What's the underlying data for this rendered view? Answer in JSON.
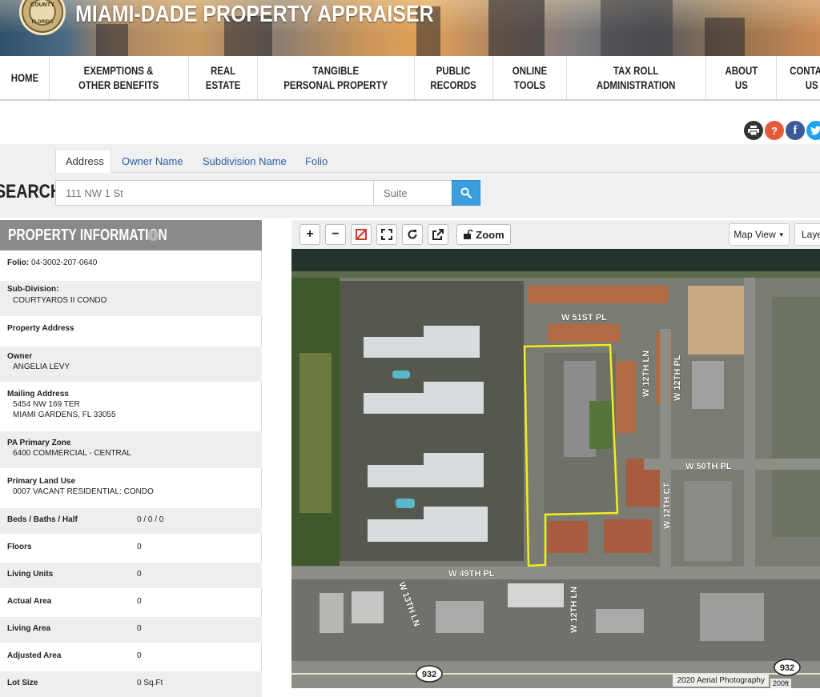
{
  "header": {
    "seal_top": "COUNTY",
    "seal_bottom": "FLORIDA",
    "site_title": "MIAMI-DADE PROPERTY APPRAISER"
  },
  "nav": {
    "items": [
      {
        "label": "HOME"
      },
      {
        "label": "EXEMPTIONS &\nOTHER BENEFITS"
      },
      {
        "label": "REAL\nESTATE"
      },
      {
        "label": "TANGIBLE\nPERSONAL PROPERTY"
      },
      {
        "label": "PUBLIC\nRECORDS"
      },
      {
        "label": "ONLINE\nTOOLS"
      },
      {
        "label": "TAX ROLL\nADMINISTRATION"
      },
      {
        "label": "ABOUT\nUS"
      },
      {
        "label": "CONTACT\nUS"
      }
    ]
  },
  "util_icons": {
    "print": "print-icon",
    "help": "?",
    "facebook": "f",
    "twitter": "twitter-icon",
    "colors": {
      "print": "#333333",
      "help": "#e8593c",
      "facebook": "#3b5998",
      "twitter": "#1da1f2"
    }
  },
  "search": {
    "tabs": [
      {
        "label": "Address"
      },
      {
        "label": "Owner Name"
      },
      {
        "label": "Subdivision Name"
      },
      {
        "label": "Folio"
      }
    ],
    "active_tab": "Address",
    "label": "SEARCH:",
    "input_placeholder": "111 NW 1 St",
    "suite_placeholder": "Suite",
    "button_color": "#3a9fdc"
  },
  "property_info": {
    "title": "PROPERTY INFORMATION",
    "folio_label": "Folio:",
    "folio_value": "04-3002-207-0640",
    "subdivision_label": "Sub-Division:",
    "subdivision_value": "COURTYARDS II CONDO",
    "property_address_label": "Property Address",
    "owner_label": "Owner",
    "owner_value": "ANGELIA LEVY",
    "mailing_label": "Mailing Address",
    "mailing_line1": "5454 NW 169 TER",
    "mailing_line2": "MIAMI GARDENS, FL 33055",
    "zone_label": "PA Primary Zone",
    "zone_value": "6400 COMMERCIAL - CENTRAL",
    "land_use_label": "Primary Land Use",
    "land_use_value": "0007 VACANT RESIDENTIAL: CONDO",
    "stats": [
      {
        "label": "Beds / Baths / Half",
        "value": "0 / 0 / 0"
      },
      {
        "label": "Floors",
        "value": "0"
      },
      {
        "label": "Living Units",
        "value": "0"
      },
      {
        "label": "Actual Area",
        "value": "0"
      },
      {
        "label": "Living Area",
        "value": "0"
      },
      {
        "label": "Adjusted Area",
        "value": "0"
      },
      {
        "label": "Lot Size",
        "value": "0 Sq.Ft"
      }
    ]
  },
  "map": {
    "tools": [
      "+",
      "−",
      "select-icon",
      "fullscreen-icon",
      "refresh-icon",
      "export-icon"
    ],
    "zoom_label": "Zoom",
    "map_view_label": "Map View",
    "layers_label": "Laye",
    "street_labels": [
      "W 51ST PL",
      "W 12TH LN",
      "W 12TH PL",
      "W 50TH PL",
      "W 12TH CT",
      "W 49TH PL",
      "W 13TH LN",
      "W 12TH LN"
    ],
    "shield_labels": [
      "932",
      "932"
    ],
    "attribution": "2020 Aerial Photography",
    "scale": "200ft",
    "parcel_outline_color": "#f2ee1a"
  }
}
